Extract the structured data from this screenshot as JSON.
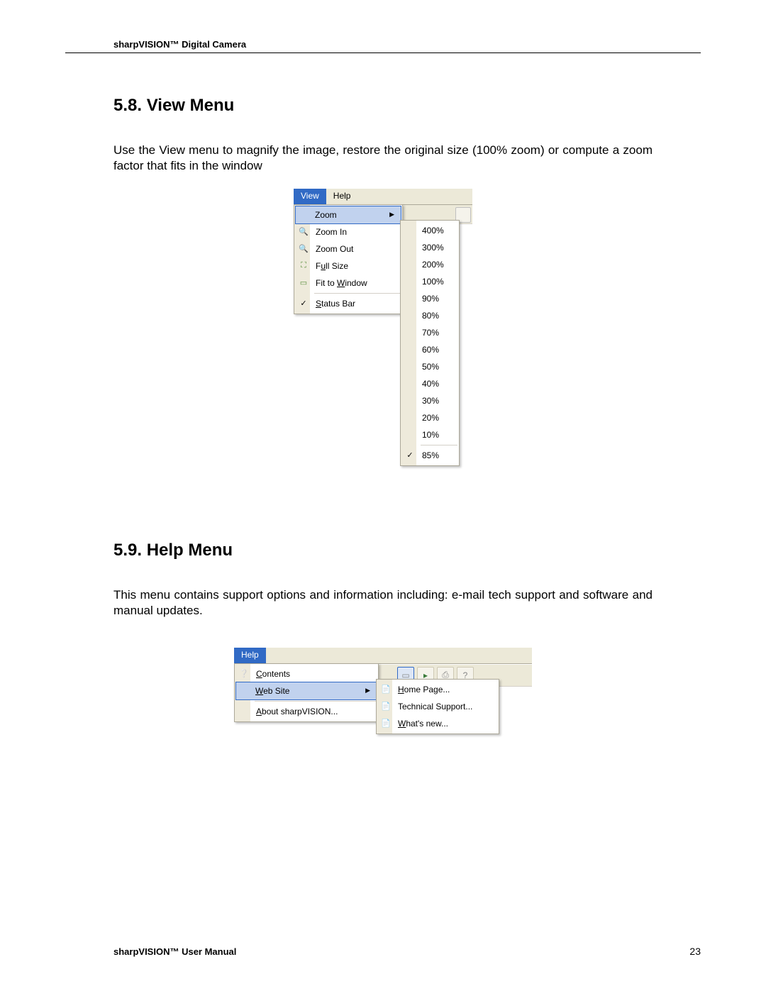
{
  "header": "sharpVISION™ Digital Camera",
  "section_view": {
    "heading": "5.8.  View Menu",
    "text": "Use the View menu to magnify the image, restore the original size (100% zoom) or compute a zoom factor that fits in the window"
  },
  "view_menu": {
    "menubar": {
      "view": "View",
      "help": "Help"
    },
    "items": {
      "zoom": "Zoom",
      "zoom_in": "Zoom In",
      "zoom_out": "Zoom Out",
      "full_size_pre": "F",
      "full_size_u": "u",
      "full_size_post": "ll Size",
      "fit_pre": "Fit to ",
      "fit_u": "W",
      "fit_post": "indow",
      "status_u": "S",
      "status_post": "tatus Bar"
    },
    "zoom_levels": [
      "400%",
      "300%",
      "200%",
      "100%",
      "90%",
      "80%",
      "70%",
      "60%",
      "50%",
      "40%",
      "30%",
      "20%",
      "10%",
      "85%"
    ]
  },
  "section_help": {
    "heading": "5.9.  Help Menu",
    "text": "This menu contains support options and information including: e-mail tech support and software and manual updates."
  },
  "help_menu": {
    "menubar": {
      "help": "Help"
    },
    "items": {
      "contents_u": "C",
      "contents_post": "ontents",
      "web_u": "W",
      "web_post": "eb Site",
      "about_u": "A",
      "about_post": "bout sharpVISION..."
    },
    "web_sub": {
      "home_u": "H",
      "home_post": "ome Page...",
      "tech": "Technical Support...",
      "whats_u": "W",
      "whats_post": "hat's new..."
    }
  },
  "footer": {
    "left": "sharpVISION™ User Manual",
    "page": "23"
  }
}
